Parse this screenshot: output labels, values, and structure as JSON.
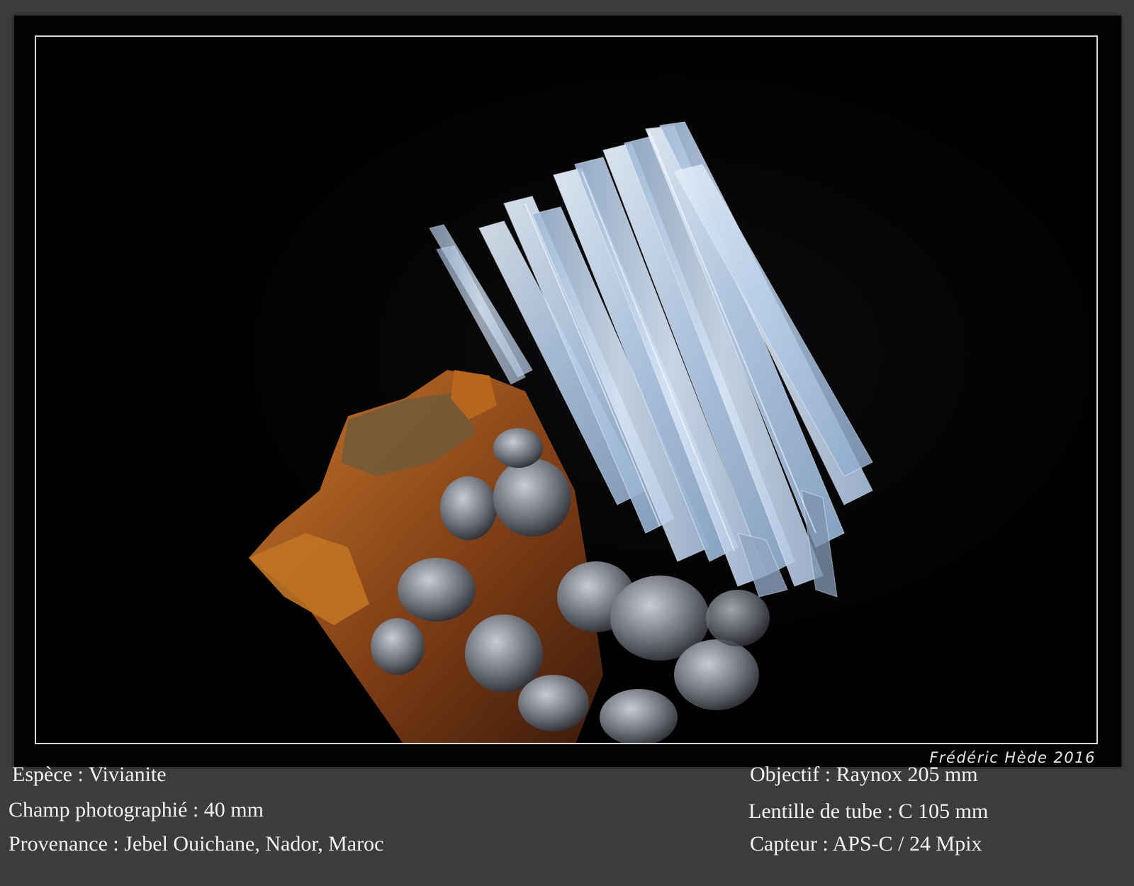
{
  "photo": {
    "subject": "vivianite-crystal-specimen",
    "colors": {
      "background": "#000000",
      "frame": "#3c3c3c",
      "border": "#d9d9d9",
      "crystal": "#bcd3ec",
      "matrix_rust": "#a65a1c",
      "calcite_grey": "#8a8e96"
    }
  },
  "signature": "Frédéric Hède 2016",
  "captions": {
    "left": [
      "Espèce : Vivianite",
      "Champ photographié : 40 mm",
      "Provenance : Jebel Ouichane, Nador, Maroc"
    ],
    "right": [
      "Objectif : Raynox 205 mm",
      "Lentille de tube : C 105 mm",
      "Capteur : APS-C / 24 Mpix"
    ]
  }
}
